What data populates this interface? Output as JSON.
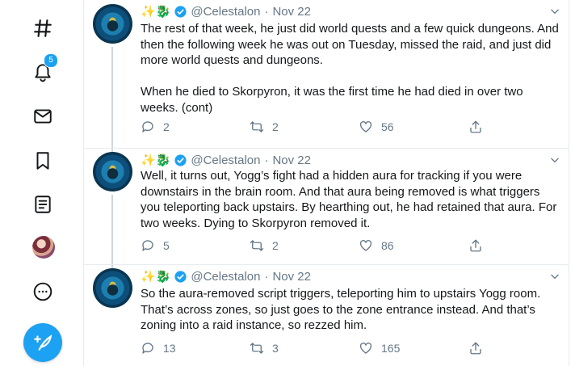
{
  "nav": {
    "notifications_badge": "5"
  },
  "tweets": [
    {
      "emoji": "✨🐉",
      "handle": "@Celestalon",
      "separator": "·",
      "date": "Nov 22",
      "text": "The rest of that week, he just did world quests and a few quick dungeons. And then the following week he was out on Tuesday, missed the raid, and just did more world quests and dungeons.\n\nWhen he died to Skorpyron, it was the first time he had died in over two weeks. (cont)",
      "replies": "2",
      "retweets": "2",
      "likes": "56"
    },
    {
      "emoji": "✨🐉",
      "handle": "@Celestalon",
      "separator": "·",
      "date": "Nov 22",
      "text": "Well, it turns out, Yogg’s fight had a hidden aura for tracking if you were downstairs in the brain room. And that aura being removed is what triggers you teleporting back upstairs. By hearthing out, he had retained that aura. For two weeks. Dying to Skorpyron removed it.",
      "replies": "5",
      "retweets": "2",
      "likes": "86"
    },
    {
      "emoji": "✨🐉",
      "handle": "@Celestalon",
      "separator": "·",
      "date": "Nov 22",
      "text": "So the aura-removed script triggers, teleporting him to upstairs Yogg room. That’s across zones, so just goes to the zone entrance instead. And that’s zoning into a raid instance, so rezzed him.",
      "replies": "13",
      "retweets": "3",
      "likes": "165"
    }
  ],
  "colors": {
    "accent": "#1da1f2",
    "text": "#14171a",
    "muted": "#657786",
    "border": "#e6ecf0"
  }
}
